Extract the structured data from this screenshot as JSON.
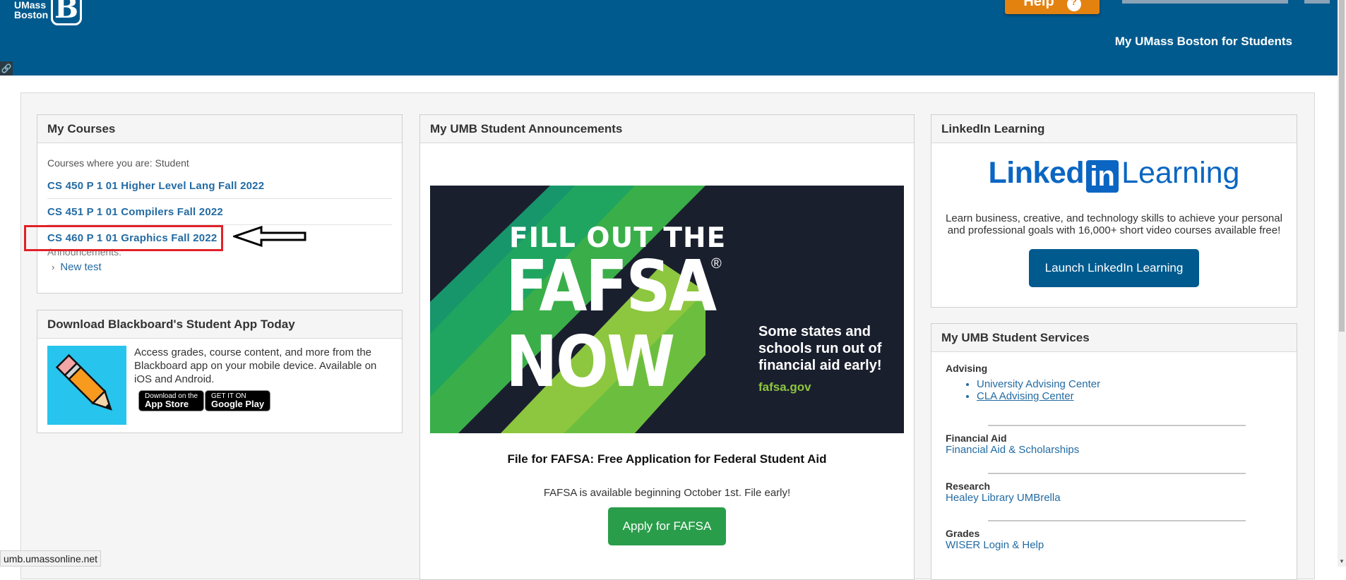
{
  "header": {
    "logo_line1": "UMass",
    "logo_line2": "Boston",
    "logo_mark": "B",
    "help_label": "Help",
    "help_icon": "?",
    "portal_title": "My UMass Boston for Students",
    "link_icon": "🔗"
  },
  "colors": {
    "header_bg": "#005a8e",
    "help_orange": "#e4820f",
    "link_blue": "#236ba3",
    "apply_green": "#2a9d4a",
    "linkedin_blue": "#0a66c2",
    "highlight_red": "#e0222a"
  },
  "my_courses": {
    "title": "My Courses",
    "role_label": "Courses where you are: Student",
    "courses": [
      {
        "label": "CS 450 P 1 01 Higher Level Lang Fall 2022"
      },
      {
        "label": "CS 451 P 1 01 Compilers Fall 2022"
      },
      {
        "label": "CS 460 P 1 01 Graphics Fall 2022"
      }
    ],
    "announcements_label": "Announcements:",
    "announcement_chevron": "›",
    "announcements": [
      {
        "label": "New test"
      }
    ]
  },
  "app_module": {
    "title": "Download Blackboard's Student App Today",
    "icon": "pencil-icon",
    "description": "Access grades, course content, and more from the Blackboard app on your mobile device. Available on iOS and Android.",
    "app_store": {
      "small": "Download on the",
      "big": "App Store"
    },
    "google_play": {
      "small": "GET IT ON",
      "big": "Google Play"
    }
  },
  "announcements_module": {
    "title": "My UMB Student Announcements",
    "banner": {
      "line1": "FILL OUT THE",
      "line2": "FAFSA",
      "line3": "NOW",
      "registered": "®",
      "side_text_1": "Some states and",
      "side_text_2": "schools run out of",
      "side_text_3": "financial aid early!",
      "url": "fafsa.gov"
    },
    "heading": "File for FAFSA: Free Application for Federal Student Aid",
    "subtext": "FAFSA is available beginning October 1st. File early!",
    "apply_label": "Apply for FAFSA"
  },
  "linkedin_module": {
    "title": "LinkedIn Learning",
    "logo_linked": "Linked",
    "logo_in": "in",
    "logo_learning": "Learning",
    "description": "Learn business, creative, and technology skills to achieve your personal and professional goals with 16,000+ short video courses available free!",
    "button_label": "Launch LinkedIn Learning"
  },
  "services_module": {
    "title": "My UMB Student Services",
    "advising": {
      "title": "Advising",
      "links": [
        "University Advising Center",
        "CLA Advising Center"
      ]
    },
    "financial_aid": {
      "title": "Financial Aid",
      "link": "Financial Aid & Scholarships"
    },
    "research": {
      "title": "Research",
      "link": "Healey Library UMBrella"
    },
    "grades": {
      "title": "Grades",
      "link": "WISER Login & Help"
    }
  },
  "status_bar": {
    "url": "umb.umassonline.net"
  },
  "scrollbar": {
    "down_arrow": "▼"
  }
}
